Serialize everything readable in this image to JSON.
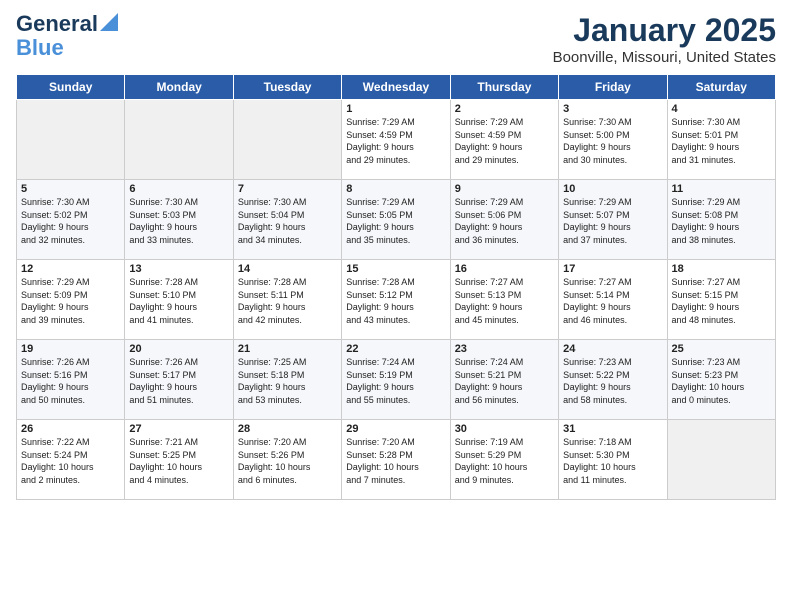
{
  "header": {
    "logo_line1": "General",
    "logo_line2": "Blue",
    "month": "January 2025",
    "location": "Boonville, Missouri, United States"
  },
  "days_of_week": [
    "Sunday",
    "Monday",
    "Tuesday",
    "Wednesday",
    "Thursday",
    "Friday",
    "Saturday"
  ],
  "weeks": [
    [
      {
        "day": "",
        "content": ""
      },
      {
        "day": "",
        "content": ""
      },
      {
        "day": "",
        "content": ""
      },
      {
        "day": "1",
        "content": "Sunrise: 7:29 AM\nSunset: 4:59 PM\nDaylight: 9 hours\nand 29 minutes."
      },
      {
        "day": "2",
        "content": "Sunrise: 7:29 AM\nSunset: 4:59 PM\nDaylight: 9 hours\nand 29 minutes."
      },
      {
        "day": "3",
        "content": "Sunrise: 7:30 AM\nSunset: 5:00 PM\nDaylight: 9 hours\nand 30 minutes."
      },
      {
        "day": "4",
        "content": "Sunrise: 7:30 AM\nSunset: 5:01 PM\nDaylight: 9 hours\nand 31 minutes."
      }
    ],
    [
      {
        "day": "5",
        "content": "Sunrise: 7:30 AM\nSunset: 5:02 PM\nDaylight: 9 hours\nand 32 minutes."
      },
      {
        "day": "6",
        "content": "Sunrise: 7:30 AM\nSunset: 5:03 PM\nDaylight: 9 hours\nand 33 minutes."
      },
      {
        "day": "7",
        "content": "Sunrise: 7:30 AM\nSunset: 5:04 PM\nDaylight: 9 hours\nand 34 minutes."
      },
      {
        "day": "8",
        "content": "Sunrise: 7:29 AM\nSunset: 5:05 PM\nDaylight: 9 hours\nand 35 minutes."
      },
      {
        "day": "9",
        "content": "Sunrise: 7:29 AM\nSunset: 5:06 PM\nDaylight: 9 hours\nand 36 minutes."
      },
      {
        "day": "10",
        "content": "Sunrise: 7:29 AM\nSunset: 5:07 PM\nDaylight: 9 hours\nand 37 minutes."
      },
      {
        "day": "11",
        "content": "Sunrise: 7:29 AM\nSunset: 5:08 PM\nDaylight: 9 hours\nand 38 minutes."
      }
    ],
    [
      {
        "day": "12",
        "content": "Sunrise: 7:29 AM\nSunset: 5:09 PM\nDaylight: 9 hours\nand 39 minutes."
      },
      {
        "day": "13",
        "content": "Sunrise: 7:28 AM\nSunset: 5:10 PM\nDaylight: 9 hours\nand 41 minutes."
      },
      {
        "day": "14",
        "content": "Sunrise: 7:28 AM\nSunset: 5:11 PM\nDaylight: 9 hours\nand 42 minutes."
      },
      {
        "day": "15",
        "content": "Sunrise: 7:28 AM\nSunset: 5:12 PM\nDaylight: 9 hours\nand 43 minutes."
      },
      {
        "day": "16",
        "content": "Sunrise: 7:27 AM\nSunset: 5:13 PM\nDaylight: 9 hours\nand 45 minutes."
      },
      {
        "day": "17",
        "content": "Sunrise: 7:27 AM\nSunset: 5:14 PM\nDaylight: 9 hours\nand 46 minutes."
      },
      {
        "day": "18",
        "content": "Sunrise: 7:27 AM\nSunset: 5:15 PM\nDaylight: 9 hours\nand 48 minutes."
      }
    ],
    [
      {
        "day": "19",
        "content": "Sunrise: 7:26 AM\nSunset: 5:16 PM\nDaylight: 9 hours\nand 50 minutes."
      },
      {
        "day": "20",
        "content": "Sunrise: 7:26 AM\nSunset: 5:17 PM\nDaylight: 9 hours\nand 51 minutes."
      },
      {
        "day": "21",
        "content": "Sunrise: 7:25 AM\nSunset: 5:18 PM\nDaylight: 9 hours\nand 53 minutes."
      },
      {
        "day": "22",
        "content": "Sunrise: 7:24 AM\nSunset: 5:19 PM\nDaylight: 9 hours\nand 55 minutes."
      },
      {
        "day": "23",
        "content": "Sunrise: 7:24 AM\nSunset: 5:21 PM\nDaylight: 9 hours\nand 56 minutes."
      },
      {
        "day": "24",
        "content": "Sunrise: 7:23 AM\nSunset: 5:22 PM\nDaylight: 9 hours\nand 58 minutes."
      },
      {
        "day": "25",
        "content": "Sunrise: 7:23 AM\nSunset: 5:23 PM\nDaylight: 10 hours\nand 0 minutes."
      }
    ],
    [
      {
        "day": "26",
        "content": "Sunrise: 7:22 AM\nSunset: 5:24 PM\nDaylight: 10 hours\nand 2 minutes."
      },
      {
        "day": "27",
        "content": "Sunrise: 7:21 AM\nSunset: 5:25 PM\nDaylight: 10 hours\nand 4 minutes."
      },
      {
        "day": "28",
        "content": "Sunrise: 7:20 AM\nSunset: 5:26 PM\nDaylight: 10 hours\nand 6 minutes."
      },
      {
        "day": "29",
        "content": "Sunrise: 7:20 AM\nSunset: 5:28 PM\nDaylight: 10 hours\nand 7 minutes."
      },
      {
        "day": "30",
        "content": "Sunrise: 7:19 AM\nSunset: 5:29 PM\nDaylight: 10 hours\nand 9 minutes."
      },
      {
        "day": "31",
        "content": "Sunrise: 7:18 AM\nSunset: 5:30 PM\nDaylight: 10 hours\nand 11 minutes."
      },
      {
        "day": "",
        "content": ""
      }
    ]
  ]
}
